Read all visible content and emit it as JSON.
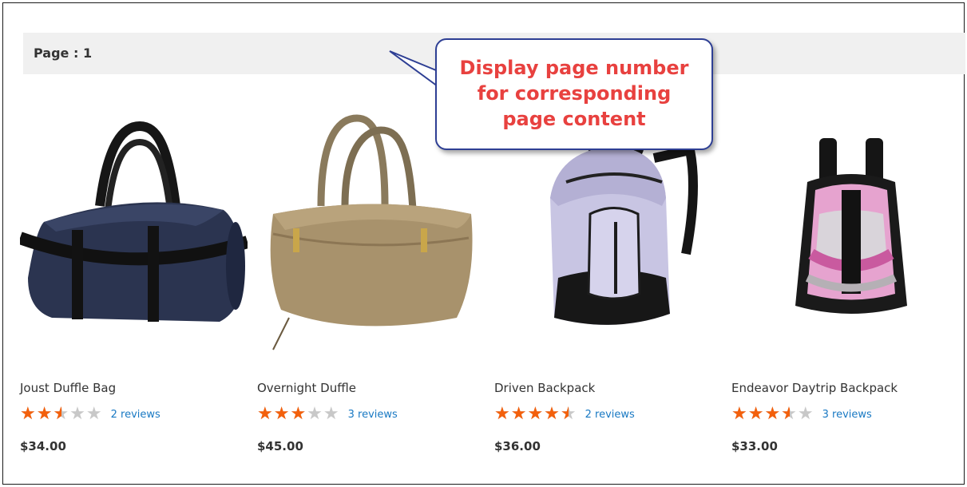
{
  "toolbar": {
    "page_label": "Page : 1"
  },
  "callout": {
    "text": "Display page number for corresponding page content"
  },
  "colors": {
    "star_filled": "#f3600c",
    "star_empty": "#c8c8c8",
    "link": "#1979c3",
    "callout_text": "#e8413f",
    "callout_border": "#2e3f94"
  },
  "products": [
    {
      "name": "Joust Duffle Bag",
      "rating_percent": 50,
      "reviews": "2 reviews",
      "price": "$34.00",
      "image": "navy-duffle-bag-image"
    },
    {
      "name": "Overnight Duffle",
      "rating_percent": 60,
      "reviews": "3 reviews",
      "price": "$45.00",
      "image": "tan-duffle-bag-image"
    },
    {
      "name": "Driven Backpack",
      "rating_percent": 90,
      "reviews": "2 reviews",
      "price": "$36.00",
      "image": "lavender-backpack-image"
    },
    {
      "name": "Endeavor Daytrip Backpack",
      "rating_percent": 70,
      "reviews": "3 reviews",
      "price": "$33.00",
      "image": "pink-backpack-image"
    }
  ]
}
